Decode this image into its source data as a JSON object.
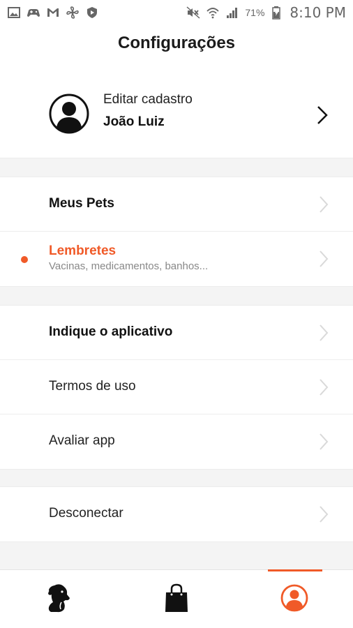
{
  "status_bar": {
    "battery_percent": "71%",
    "time": "8:10 PM",
    "left_icons": [
      "image-icon",
      "gamepad-icon",
      "gmail-icon",
      "fan-icon",
      "shield-icon"
    ],
    "right_icons": [
      "mute-icon",
      "wifi-icon",
      "signal-icon",
      "battery-icon"
    ]
  },
  "header": {
    "title": "Configurações"
  },
  "profile": {
    "subtitle": "Editar cadastro",
    "name": "João Luiz",
    "icon": "user-avatar-icon"
  },
  "menu": {
    "pets": "Meus Pets",
    "reminders": {
      "label": "Lembretes",
      "subtitle": "Vacinas, medicamentos, banhos..."
    },
    "recommend": "Indique o aplicativo",
    "terms": "Termos de uso",
    "rate": "Avaliar app",
    "logout": "Desconectar"
  },
  "tabs": [
    {
      "icon": "dog-icon",
      "active": false
    },
    {
      "icon": "shopping-bag-icon",
      "active": false
    },
    {
      "icon": "profile-icon",
      "active": true
    }
  ],
  "colors": {
    "accent": "#f05a28",
    "text": "#111111",
    "muted": "#888888",
    "separator": "#f4f4f4"
  }
}
